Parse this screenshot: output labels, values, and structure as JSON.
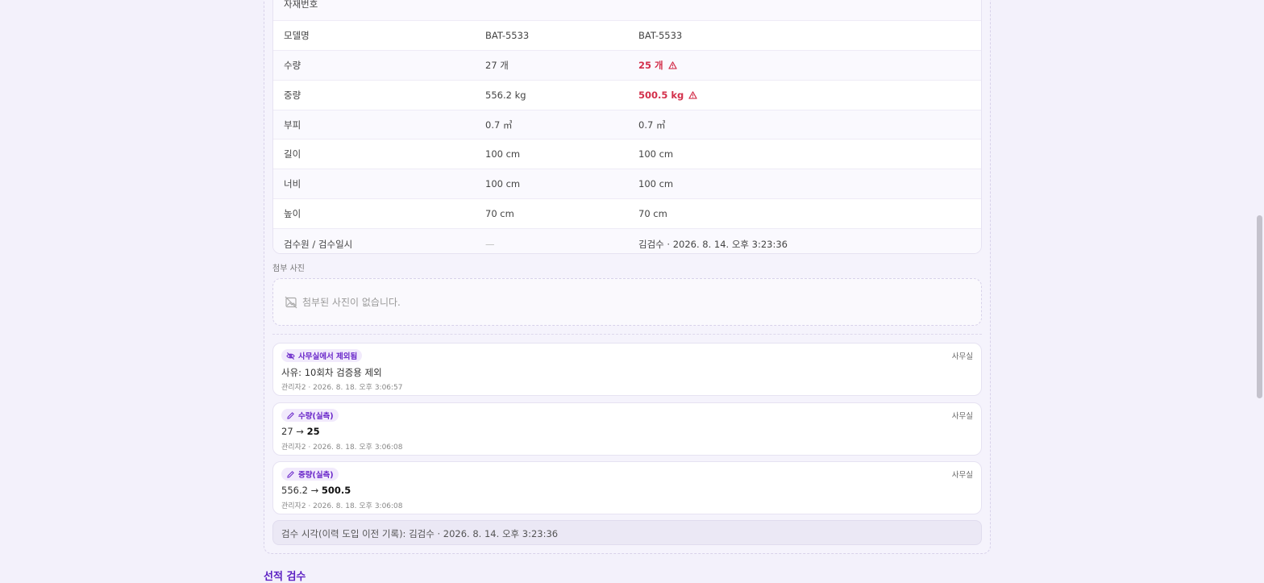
{
  "table": {
    "rows": [
      {
        "label": "자재번호",
        "before": "",
        "after": "",
        "after_warn": false
      },
      {
        "label": "모델명",
        "before": "BAT-5533",
        "after": "BAT-5533",
        "after_warn": false
      },
      {
        "label": "수량",
        "before": "27 개",
        "after": "25 개",
        "after_warn": true
      },
      {
        "label": "중량",
        "before": "556.2 kg",
        "after": "500.5 kg",
        "after_warn": true
      },
      {
        "label": "부피",
        "before": "0.7 ㎥",
        "after": "0.7 ㎥",
        "after_warn": false
      },
      {
        "label": "길이",
        "before": "100 cm",
        "after": "100 cm",
        "after_warn": false
      },
      {
        "label": "너비",
        "before": "100 cm",
        "after": "100 cm",
        "after_warn": false
      },
      {
        "label": "높이",
        "before": "70 cm",
        "after": "70 cm",
        "after_warn": false
      },
      {
        "label": "검수원 / 검수일시",
        "before": "—",
        "after": "김검수 · 2026. 8. 14. 오후 3:23:36",
        "after_warn": false
      }
    ]
  },
  "photos": {
    "section_label": "첨부 사진",
    "empty_text": "첨부된 사진이 없습니다.",
    "empty_icon": "no-image-icon"
  },
  "history": [
    {
      "badge": "사무실에서 제외됨",
      "badge_icon": "eye-off-icon",
      "where": "사무실",
      "body_prefix": "사유: 10회차 검증용 제외",
      "body_from": "",
      "body_to": "",
      "meta": "관리자2 · 2026. 8. 18. 오후 3:06:57"
    },
    {
      "badge": "수량(실측)",
      "badge_icon": "pencil-icon",
      "where": "사무실",
      "body_prefix": "",
      "body_from": "27",
      "body_to": "25",
      "meta": "관리자2 · 2026. 8. 18. 오후 3:06:08"
    },
    {
      "badge": "중량(실측)",
      "badge_icon": "pencil-icon",
      "where": "사무실",
      "body_prefix": "",
      "body_from": "556.2",
      "body_to": "500.5",
      "meta": "관리자2 · 2026. 8. 18. 오후 3:06:08"
    }
  ],
  "arrow": "→",
  "warn_icon": "warning-triangle-icon",
  "footer_note": "검수 시각(이력 도입 이전 기록): 김검수 · 2026. 8. 14. 오후 3:23:36",
  "next_section_title": "선적 검수",
  "colors": {
    "accent": "#6a27c9",
    "warn": "#d3304b",
    "background": "#f3f1fb"
  }
}
